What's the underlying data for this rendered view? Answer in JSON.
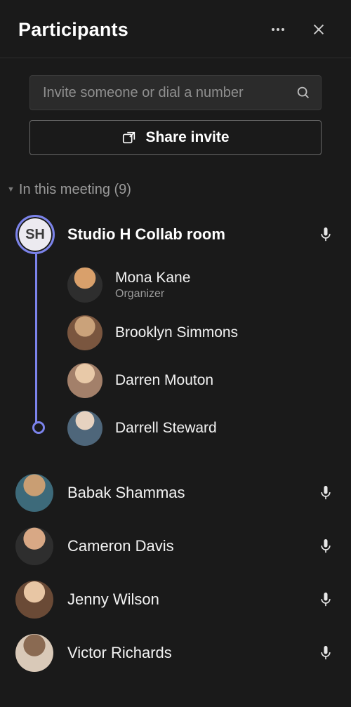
{
  "header": {
    "title": "Participants",
    "more_icon": "more-options",
    "close_icon": "close"
  },
  "invite": {
    "placeholder": "Invite someone or dial a number",
    "share_label": "Share invite"
  },
  "section": {
    "label": "In this meeting (9)"
  },
  "room": {
    "initials": "SH",
    "name": "Studio H Collab room",
    "mic": true,
    "members": [
      {
        "name": "Mona Kane",
        "role": "Organizer",
        "avatar": "av-mona"
      },
      {
        "name": "Brooklyn Simmons",
        "role": "",
        "avatar": "av-brook"
      },
      {
        "name": "Darren Mouton",
        "role": "",
        "avatar": "av-darren"
      },
      {
        "name": "Darrell Steward",
        "role": "",
        "avatar": "av-darrell"
      }
    ]
  },
  "participants": [
    {
      "name": "Babak Shammas",
      "avatar": "av-babak",
      "mic": true
    },
    {
      "name": "Cameron Davis",
      "avatar": "av-cam",
      "mic": true
    },
    {
      "name": "Jenny Wilson",
      "avatar": "av-jenny",
      "mic": true
    },
    {
      "name": "Victor Richards",
      "avatar": "av-victor",
      "mic": true
    }
  ]
}
